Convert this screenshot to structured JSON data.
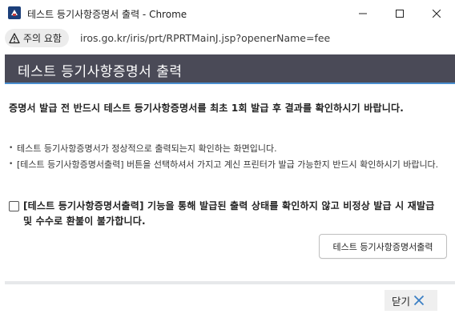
{
  "window": {
    "title": "테스트 등기사항증명서 출력 - Chrome",
    "icon": "chrome-app-icon",
    "controls": [
      "minimize-icon",
      "maximize-icon",
      "close-icon"
    ]
  },
  "addressbar": {
    "security_label": "주의 요함",
    "security_icon": "warning-triangle-icon",
    "url": "iros.go.kr/iris/prt/RPRTMainJ.jsp?openerName=fee"
  },
  "page": {
    "header_title": "테스트 등기사항증명서 출력",
    "notice": "증명서 발급 전 반드시 테스트 등기사항증명서를 최초 1회 발급 후 결과를 확인하시기 바랍니다.",
    "bullets": [
      "테스트 등기사항증명서가 정상적으로 출력되는지 확인하는 화면입니다.",
      "[테스트 등기사항증명서출력] 버튼을 선택하셔서 가지고 계신 프린터가 발급 가능한지 반드시 확인하시기 바랍니다."
    ],
    "checkbox_label": "[테스트 등기사항증명서출력] 기능을 통해 발급된 출력 상태를 확인하지 않고 비정상 발급 시 재발급 및 수수로 환불이 불가합니다.",
    "checkbox_checked": false,
    "print_button": "테스트 등기사항증명서출력",
    "close_button": "닫기"
  },
  "colors": {
    "header_bg": "#4a4a57",
    "header_accent": "#4a8fd0",
    "close_icon": "#3b7fc4"
  }
}
